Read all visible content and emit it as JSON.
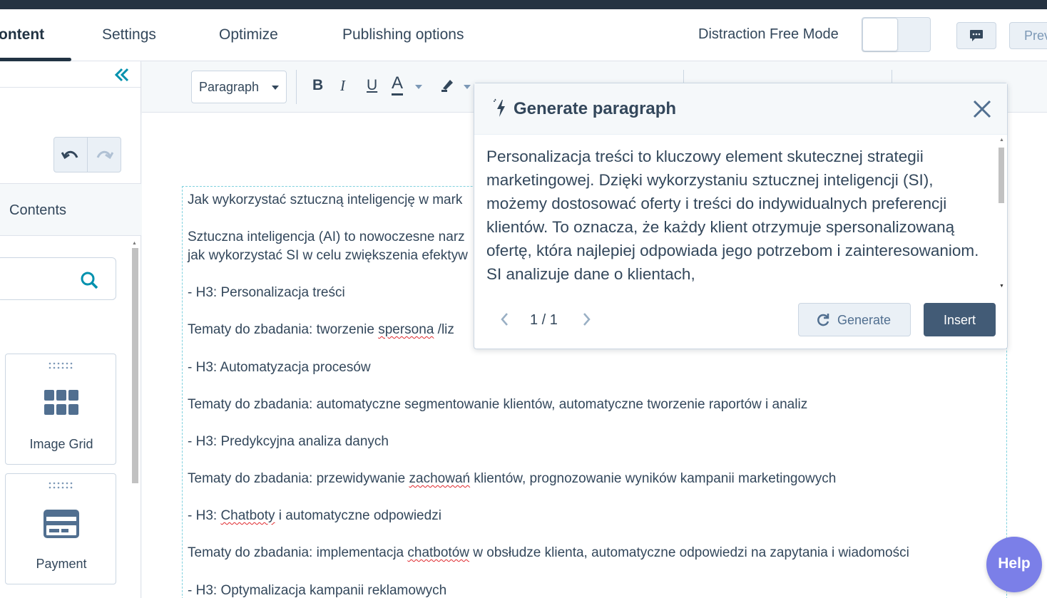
{
  "tabs": {
    "content": "ontent",
    "settings": "Settings",
    "optimize": "Optimize",
    "publishing": "Publishing options"
  },
  "header": {
    "distraction_free_label": "Distraction Free Mode",
    "distraction_free_enabled": false,
    "preview_label": "Prev"
  },
  "sidebar": {
    "contents_label": "Contents",
    "modules": [
      {
        "label": "Image Grid",
        "icon": "image-grid-icon"
      },
      {
        "label": "Payment",
        "icon": "payment-card-icon"
      }
    ]
  },
  "toolbar": {
    "block_format": "Paragraph",
    "bold": "B",
    "italic": "I",
    "underline": "U",
    "text_color": "A"
  },
  "document": {
    "lines": [
      {
        "text": "Jak wykorzystać sztuczną inteligencję w mark"
      },
      {
        "text": "Sztuczna inteligencja (AI) to nowoczesne narz"
      },
      {
        "text": "jak wykorzystać SI w celu zwiększenia efektyw"
      },
      {
        "text": "- H3: Personalizacja treści"
      },
      {
        "pre": "Tematy do zbadania: tworzenie ",
        "err": "spersona",
        "post": " /liz"
      },
      {
        "text": "- H3: Automatyzacja procesów"
      },
      {
        "text": "Tematy do zbadania: automatyczne segmentowanie klientów, automatyczne tworzenie raportów i analiz"
      },
      {
        "text": "- H3: Predykcyjna analiza danych"
      },
      {
        "pre": "Tematy do zbadania: przewidywanie ",
        "err": "zachowań",
        "post": " klientów, prognozowanie wyników kampanii marketingowych"
      },
      {
        "pre": "- H3: ",
        "err": "Chatboty",
        "post": " i automatyczne odpowiedzi"
      },
      {
        "pre": "Tematy do zbadania: implementacja ",
        "err": "chatbotów",
        "post": " w obsłudze klienta, automatyczne odpowiedzi na zapytania i wiadomości"
      },
      {
        "text": "- H3: Optymalizacja kampanii reklamowych"
      }
    ]
  },
  "popup": {
    "title": "Generate paragraph",
    "generated_text": "Personalizacja treści to kluczowy element skutecznej strategii marketingowej. Dzięki wykorzystaniu sztucznej inteligencji (SI), możemy dostosować oferty i treści do indywidualnych preferencji klientów. To oznacza, że każdy klient otrzymuje spersonalizowaną ofertę, która najlepiej odpowiada jego potrzebom i zainteresowaniom. SI analizuje dane o klientach,",
    "pagination": "1 / 1",
    "generate_label": "Generate",
    "insert_label": "Insert"
  },
  "help_label": "Help",
  "colors": {
    "topbar": "#253342",
    "primary_button": "#425b76",
    "help_button": "#7b7fe8",
    "accent_teal": "#0091ae",
    "spellcheck_error": "#e0282d"
  }
}
